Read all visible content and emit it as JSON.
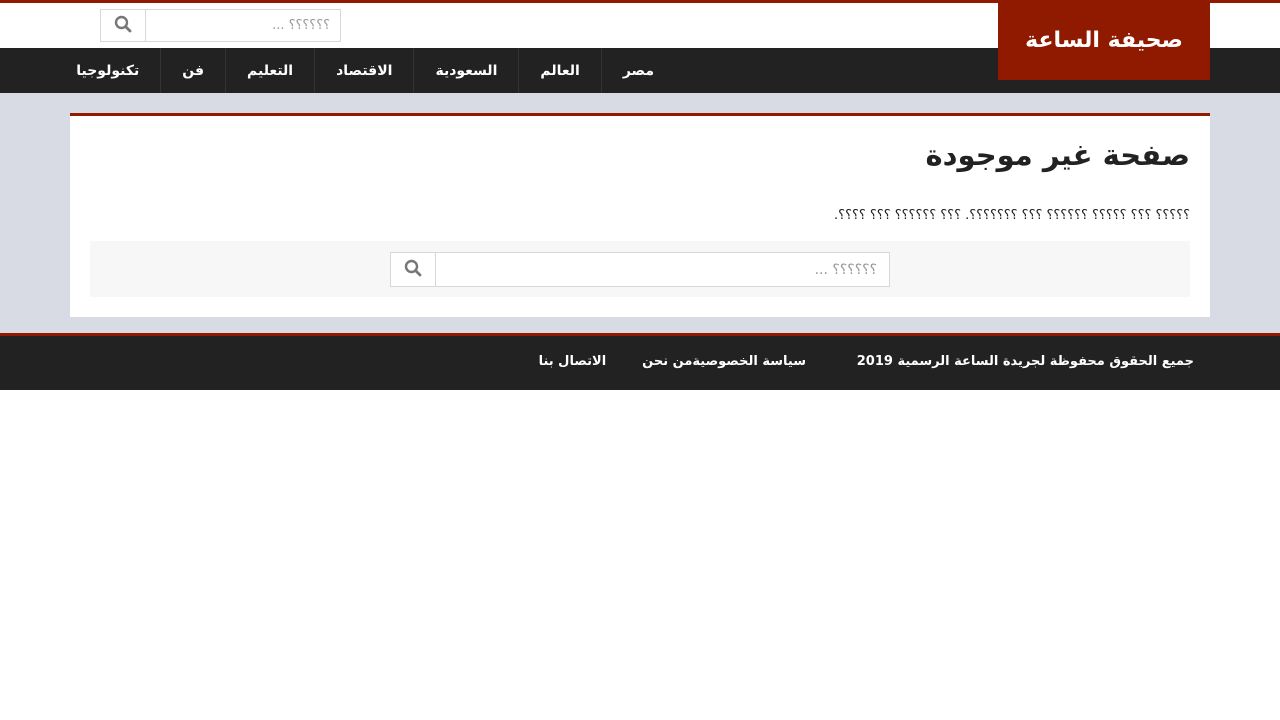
{
  "logo": {
    "text": "صحيفة الساعة"
  },
  "header_search": {
    "placeholder": "؟؟؟؟؟؟ ...",
    "icon": "search-icon"
  },
  "nav": {
    "items": [
      {
        "label": "مصر"
      },
      {
        "label": "العالم"
      },
      {
        "label": "السعودية"
      },
      {
        "label": "الاقتصاد"
      },
      {
        "label": "التعليم"
      },
      {
        "label": "فن"
      },
      {
        "label": "تكنولوجيا"
      }
    ]
  },
  "main": {
    "title": "صفحة غير موجودة",
    "message": "؟؟؟؟؟ ؟؟؟ ؟؟؟؟؟ ؟؟؟؟؟؟ ؟؟؟ ؟؟؟؟؟؟؟. ؟؟؟ ؟؟؟؟؟؟ ؟؟؟ ؟؟؟؟.",
    "search": {
      "placeholder": "؟؟؟؟؟؟ ...",
      "icon": "search-icon"
    }
  },
  "footer": {
    "copyright": "جميع الحقوق محفوظة لجريدة الساعة الرسمية 2019",
    "links": [
      {
        "label": "سياسة الخصوصية"
      },
      {
        "label": "من نحن"
      },
      {
        "label": "الاتصال بنا"
      }
    ]
  },
  "colors": {
    "brand": "#8f1a00",
    "nav_bg": "#222222",
    "page_bg": "#d8dbe4"
  }
}
